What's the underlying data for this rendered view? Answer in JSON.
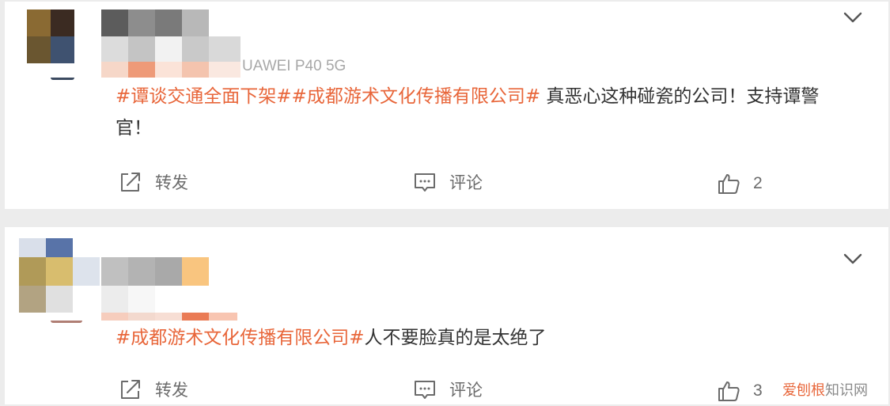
{
  "colors": {
    "topic": "#e8663a",
    "text": "#333333",
    "meta": "#a8a8a8",
    "action": "#6b6b6b"
  },
  "icons": {
    "repost": "repost-icon",
    "comment": "comment-icon",
    "like": "thumbs-up-icon",
    "more": "chevron-down-icon"
  },
  "comments": [
    {
      "device": "UAWEI P40 5G",
      "topics": [
        "#谭谈交通全面下架#",
        "#成都游术文化传播有限公司#"
      ],
      "body_line1": " 真恶心这种碰瓷的公司！支持谭警",
      "body_line2": "官！",
      "repost_label": "转发",
      "comment_label": "评论",
      "like_count": "2"
    },
    {
      "topics": [
        "#成都游术文化传播有限公司#"
      ],
      "body_line1": "人不要脸真的是太绝了",
      "repost_label": "转发",
      "comment_label": "评论",
      "like_count": "3"
    }
  ],
  "watermark": {
    "part1": "爱刨根",
    "part2": "知识网"
  }
}
